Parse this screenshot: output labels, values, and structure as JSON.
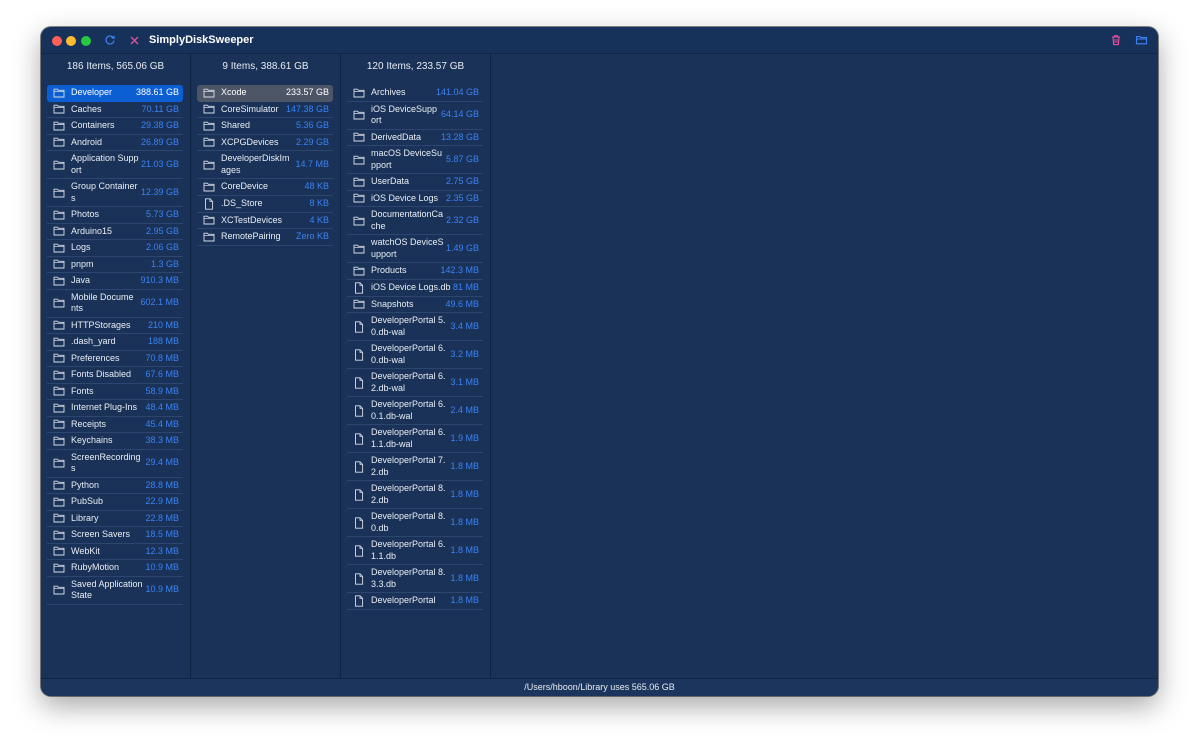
{
  "window": {
    "title": "SimplyDiskSweeper",
    "accent": "#3a82f5",
    "trash_color": "#ec4fa0",
    "close_color": "#ec4fa0"
  },
  "columns": [
    {
      "header": "186 Items, 565.06 GB",
      "selected": 0,
      "selection_style": "blue",
      "items": [
        {
          "name": "Developer",
          "size": "388.61 GB",
          "icon": "folder-icon"
        },
        {
          "name": "Caches",
          "size": "70.11 GB",
          "icon": "folder-icon"
        },
        {
          "name": "Containers",
          "size": "29.38 GB",
          "icon": "folder-icon"
        },
        {
          "name": "Android",
          "size": "26.89 GB",
          "icon": "folder-icon"
        },
        {
          "name": "Application Support",
          "size": "21.03 GB",
          "icon": "folder-icon"
        },
        {
          "name": "Group Containers",
          "size": "12.39 GB",
          "icon": "folder-icon"
        },
        {
          "name": "Photos",
          "size": "5.73 GB",
          "icon": "folder-icon"
        },
        {
          "name": "Arduino15",
          "size": "2.95 GB",
          "icon": "folder-icon"
        },
        {
          "name": "Logs",
          "size": "2.06 GB",
          "icon": "folder-icon"
        },
        {
          "name": "pnpm",
          "size": "1.3 GB",
          "icon": "folder-icon"
        },
        {
          "name": "Java",
          "size": "910.3 MB",
          "icon": "folder-icon"
        },
        {
          "name": "Mobile Documents",
          "size": "602.1 MB",
          "icon": "folder-icon"
        },
        {
          "name": "HTTPStorages",
          "size": "210 MB",
          "icon": "folder-icon"
        },
        {
          "name": ".dash_yard",
          "size": "188 MB",
          "icon": "folder-icon"
        },
        {
          "name": "Preferences",
          "size": "70.8 MB",
          "icon": "folder-icon"
        },
        {
          "name": "Fonts Disabled",
          "size": "67.6 MB",
          "icon": "folder-icon"
        },
        {
          "name": "Fonts",
          "size": "58.9 MB",
          "icon": "folder-icon"
        },
        {
          "name": "Internet Plug-Ins",
          "size": "48.4 MB",
          "icon": "folder-icon"
        },
        {
          "name": "Receipts",
          "size": "45.4 MB",
          "icon": "folder-icon"
        },
        {
          "name": "Keychains",
          "size": "38.3 MB",
          "icon": "folder-icon"
        },
        {
          "name": "ScreenRecordings",
          "size": "29.4 MB",
          "icon": "folder-icon"
        },
        {
          "name": "Python",
          "size": "28.8 MB",
          "icon": "folder-icon"
        },
        {
          "name": "PubSub",
          "size": "22.9 MB",
          "icon": "folder-icon"
        },
        {
          "name": "Library",
          "size": "22.8 MB",
          "icon": "folder-icon"
        },
        {
          "name": "Screen Savers",
          "size": "18.5 MB",
          "icon": "folder-icon"
        },
        {
          "name": "WebKit",
          "size": "12.3 MB",
          "icon": "folder-icon"
        },
        {
          "name": "RubyMotion",
          "size": "10.9 MB",
          "icon": "folder-icon"
        },
        {
          "name": "Saved Application State",
          "size": "10.9 MB",
          "icon": "folder-icon"
        }
      ]
    },
    {
      "header": "9 Items, 388.61 GB",
      "selected": 0,
      "selection_style": "gray",
      "items": [
        {
          "name": "Xcode",
          "size": "233.57 GB",
          "icon": "folder-icon"
        },
        {
          "name": "CoreSimulator",
          "size": "147.38 GB",
          "icon": "folder-icon"
        },
        {
          "name": "Shared",
          "size": "5.36 GB",
          "icon": "folder-icon"
        },
        {
          "name": "XCPGDevices",
          "size": "2.29 GB",
          "icon": "folder-icon"
        },
        {
          "name": "DeveloperDiskImages",
          "size": "14.7 MB",
          "icon": "folder-icon"
        },
        {
          "name": "CoreDevice",
          "size": "48 KB",
          "icon": "folder-icon"
        },
        {
          "name": ".DS_Store",
          "size": "8 KB",
          "icon": "file-icon"
        },
        {
          "name": "XCTestDevices",
          "size": "4 KB",
          "icon": "folder-icon"
        },
        {
          "name": "RemotePairing",
          "size": "Zero KB",
          "icon": "folder-icon"
        }
      ]
    },
    {
      "header": "120 Items, 233.57 GB",
      "selected": -1,
      "selection_style": "none",
      "items": [
        {
          "name": "Archives",
          "size": "141.04 GB",
          "icon": "folder-icon"
        },
        {
          "name": "iOS DeviceSupport",
          "size": "64.14 GB",
          "icon": "folder-icon"
        },
        {
          "name": "DerivedData",
          "size": "13.28 GB",
          "icon": "folder-icon"
        },
        {
          "name": "macOS DeviceSupport",
          "size": "5.87 GB",
          "icon": "folder-icon"
        },
        {
          "name": "UserData",
          "size": "2.75 GB",
          "icon": "folder-icon"
        },
        {
          "name": "iOS Device Logs",
          "size": "2.35 GB",
          "icon": "folder-icon"
        },
        {
          "name": "DocumentationCache",
          "size": "2.32 GB",
          "icon": "folder-icon"
        },
        {
          "name": "watchOS DeviceSupport",
          "size": "1.49 GB",
          "icon": "folder-icon"
        },
        {
          "name": "Products",
          "size": "142.3 MB",
          "icon": "folder-icon"
        },
        {
          "name": "iOS Device Logs.db",
          "size": "81 MB",
          "icon": "file-icon"
        },
        {
          "name": "Snapshots",
          "size": "49.6 MB",
          "icon": "folder-icon"
        },
        {
          "name": "DeveloperPortal 5.0.db-wal",
          "size": "3.4 MB",
          "icon": "file-icon"
        },
        {
          "name": "DeveloperPortal 6.0.db-wal",
          "size": "3.2 MB",
          "icon": "file-icon"
        },
        {
          "name": "DeveloperPortal 6.2.db-wal",
          "size": "3.1 MB",
          "icon": "file-icon"
        },
        {
          "name": "DeveloperPortal 6.0.1.db-wal",
          "size": "2.4 MB",
          "icon": "file-icon"
        },
        {
          "name": "DeveloperPortal 6.1.1.db-wal",
          "size": "1.9 MB",
          "icon": "file-icon"
        },
        {
          "name": "DeveloperPortal 7.2.db",
          "size": "1.8 MB",
          "icon": "file-icon"
        },
        {
          "name": "DeveloperPortal 8.2.db",
          "size": "1.8 MB",
          "icon": "file-icon"
        },
        {
          "name": "DeveloperPortal 8.0.db",
          "size": "1.8 MB",
          "icon": "file-icon"
        },
        {
          "name": "DeveloperPortal 6.1.1.db",
          "size": "1.8 MB",
          "icon": "file-icon"
        },
        {
          "name": "DeveloperPortal 8.3.3.db",
          "size": "1.8 MB",
          "icon": "file-icon"
        },
        {
          "name": "DeveloperPortal",
          "size": "1.8 MB",
          "icon": "file-icon"
        }
      ]
    }
  ],
  "status": "/Users/hboon/Library uses 565.06 GB"
}
